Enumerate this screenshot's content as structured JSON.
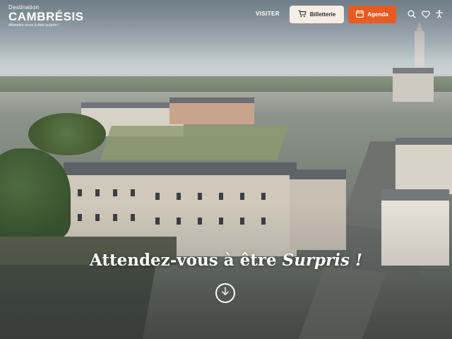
{
  "header": {
    "logo": {
      "line1": "Destination",
      "line2": "CAMBRÉSIS",
      "tagline": "Attendez-vous à être surpris !"
    },
    "nav": {
      "visit_label": "VISITER"
    },
    "ticket_button_label": "Billetterie",
    "agenda_button_label": "Agenda",
    "icons": [
      "search-icon",
      "heart-icon",
      "accessibility-icon",
      "cart-icon",
      "calendar-icon"
    ]
  },
  "hero": {
    "headline_main": "Attendez-vous à être",
    "headline_accent": "Surpris !"
  },
  "colors": {
    "accent": "#e85c23",
    "ticket_bg": "#f6eee4",
    "text_light": "#ffffff"
  }
}
